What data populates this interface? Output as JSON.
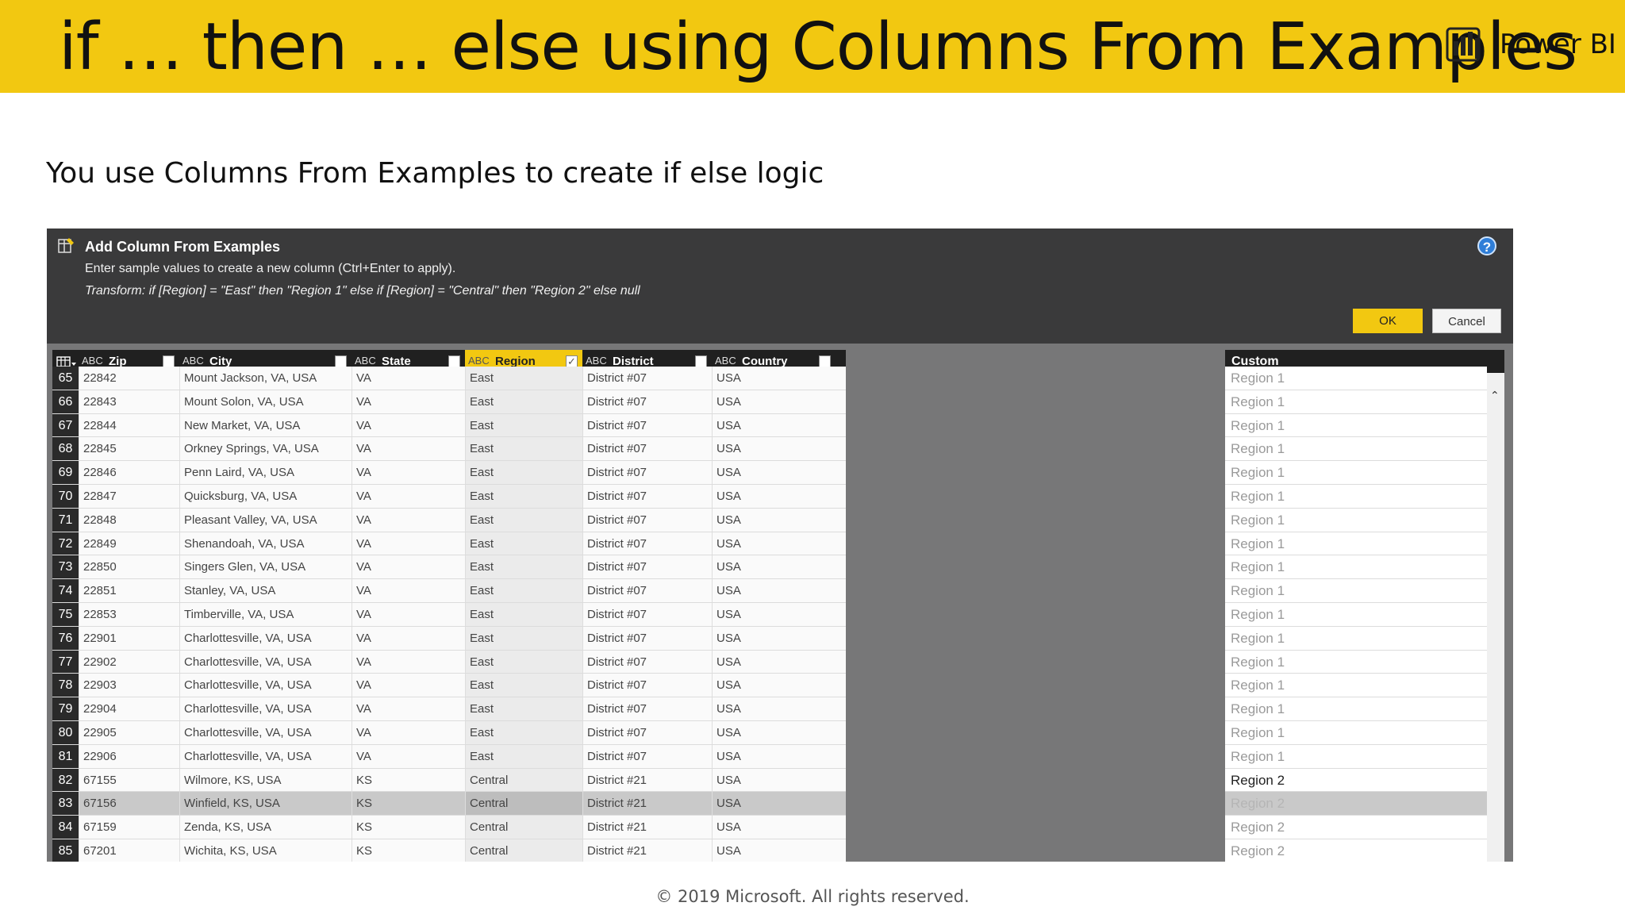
{
  "slide": {
    "title": "if … then … else using Columns From Examples",
    "brand": "Power BI",
    "subtitle": "You use Columns From Examples to create if else logic",
    "footer": "© 2019 Microsoft. All rights reserved."
  },
  "dialog": {
    "title": "Add Column From Examples",
    "description": "Enter sample values to create a new column (Ctrl+Enter to apply).",
    "transform": "Transform: if [Region] = \"East\" then \"Region 1\" else if [Region] = \"Central\" then \"Region 2\" else null",
    "help_label": "?",
    "ok_label": "OK",
    "cancel_label": "Cancel"
  },
  "grid": {
    "type_glyph": "ABC",
    "columns": [
      {
        "name": "Zip",
        "checked": false
      },
      {
        "name": "City",
        "checked": false
      },
      {
        "name": "State",
        "checked": false
      },
      {
        "name": "Region",
        "checked": true
      },
      {
        "name": "District",
        "checked": false
      },
      {
        "name": "Country",
        "checked": false
      }
    ],
    "rows": [
      {
        "n": "65",
        "zip": "22842",
        "city": "Mount Jackson, VA, USA",
        "state": "VA",
        "region": "East",
        "district": "District #07",
        "country": "USA"
      },
      {
        "n": "66",
        "zip": "22843",
        "city": "Mount Solon, VA, USA",
        "state": "VA",
        "region": "East",
        "district": "District #07",
        "country": "USA"
      },
      {
        "n": "67",
        "zip": "22844",
        "city": "New Market, VA, USA",
        "state": "VA",
        "region": "East",
        "district": "District #07",
        "country": "USA"
      },
      {
        "n": "68",
        "zip": "22845",
        "city": "Orkney Springs, VA, USA",
        "state": "VA",
        "region": "East",
        "district": "District #07",
        "country": "USA"
      },
      {
        "n": "69",
        "zip": "22846",
        "city": "Penn Laird, VA, USA",
        "state": "VA",
        "region": "East",
        "district": "District #07",
        "country": "USA"
      },
      {
        "n": "70",
        "zip": "22847",
        "city": "Quicksburg, VA, USA",
        "state": "VA",
        "region": "East",
        "district": "District #07",
        "country": "USA"
      },
      {
        "n": "71",
        "zip": "22848",
        "city": "Pleasant Valley, VA, USA",
        "state": "VA",
        "region": "East",
        "district": "District #07",
        "country": "USA"
      },
      {
        "n": "72",
        "zip": "22849",
        "city": "Shenandoah, VA, USA",
        "state": "VA",
        "region": "East",
        "district": "District #07",
        "country": "USA"
      },
      {
        "n": "73",
        "zip": "22850",
        "city": "Singers Glen, VA, USA",
        "state": "VA",
        "region": "East",
        "district": "District #07",
        "country": "USA"
      },
      {
        "n": "74",
        "zip": "22851",
        "city": "Stanley, VA, USA",
        "state": "VA",
        "region": "East",
        "district": "District #07",
        "country": "USA"
      },
      {
        "n": "75",
        "zip": "22853",
        "city": "Timberville, VA, USA",
        "state": "VA",
        "region": "East",
        "district": "District #07",
        "country": "USA"
      },
      {
        "n": "76",
        "zip": "22901",
        "city": "Charlottesville, VA, USA",
        "state": "VA",
        "region": "East",
        "district": "District #07",
        "country": "USA"
      },
      {
        "n": "77",
        "zip": "22902",
        "city": "Charlottesville, VA, USA",
        "state": "VA",
        "region": "East",
        "district": "District #07",
        "country": "USA"
      },
      {
        "n": "78",
        "zip": "22903",
        "city": "Charlottesville, VA, USA",
        "state": "VA",
        "region": "East",
        "district": "District #07",
        "country": "USA"
      },
      {
        "n": "79",
        "zip": "22904",
        "city": "Charlottesville, VA, USA",
        "state": "VA",
        "region": "East",
        "district": "District #07",
        "country": "USA"
      },
      {
        "n": "80",
        "zip": "22905",
        "city": "Charlottesville, VA, USA",
        "state": "VA",
        "region": "East",
        "district": "District #07",
        "country": "USA"
      },
      {
        "n": "81",
        "zip": "22906",
        "city": "Charlottesville, VA, USA",
        "state": "VA",
        "region": "East",
        "district": "District #07",
        "country": "USA"
      },
      {
        "n": "82",
        "zip": "67155",
        "city": "Wilmore, KS, USA",
        "state": "KS",
        "region": "Central",
        "district": "District #21",
        "country": "USA"
      },
      {
        "n": "83",
        "zip": "67156",
        "city": "Winfield, KS, USA",
        "state": "KS",
        "region": "Central",
        "district": "District #21",
        "country": "USA",
        "highlight": true
      },
      {
        "n": "84",
        "zip": "67159",
        "city": "Zenda, KS, USA",
        "state": "KS",
        "region": "Central",
        "district": "District #21",
        "country": "USA"
      },
      {
        "n": "85",
        "zip": "67201",
        "city": "Wichita, KS, USA",
        "state": "KS",
        "region": "Central",
        "district": "District #21",
        "country": "USA"
      }
    ]
  },
  "custom": {
    "header": "Custom",
    "values": [
      "Region 1",
      "Region 1",
      "Region 1",
      "Region 1",
      "Region 1",
      "Region 1",
      "Region 1",
      "Region 1",
      "Region 1",
      "Region 1",
      "Region 1",
      "Region 1",
      "Region 1",
      "Region 1",
      "Region 1",
      "Region 1",
      "Region 1",
      "Region 2",
      "Region 2",
      "Region 2",
      "Region 2"
    ],
    "input_row_index": 17,
    "highlight_row_index": 18
  },
  "colors": {
    "accent": "#f2c811",
    "dialog_bg": "#3a3a3b",
    "header_bg": "#202020"
  }
}
